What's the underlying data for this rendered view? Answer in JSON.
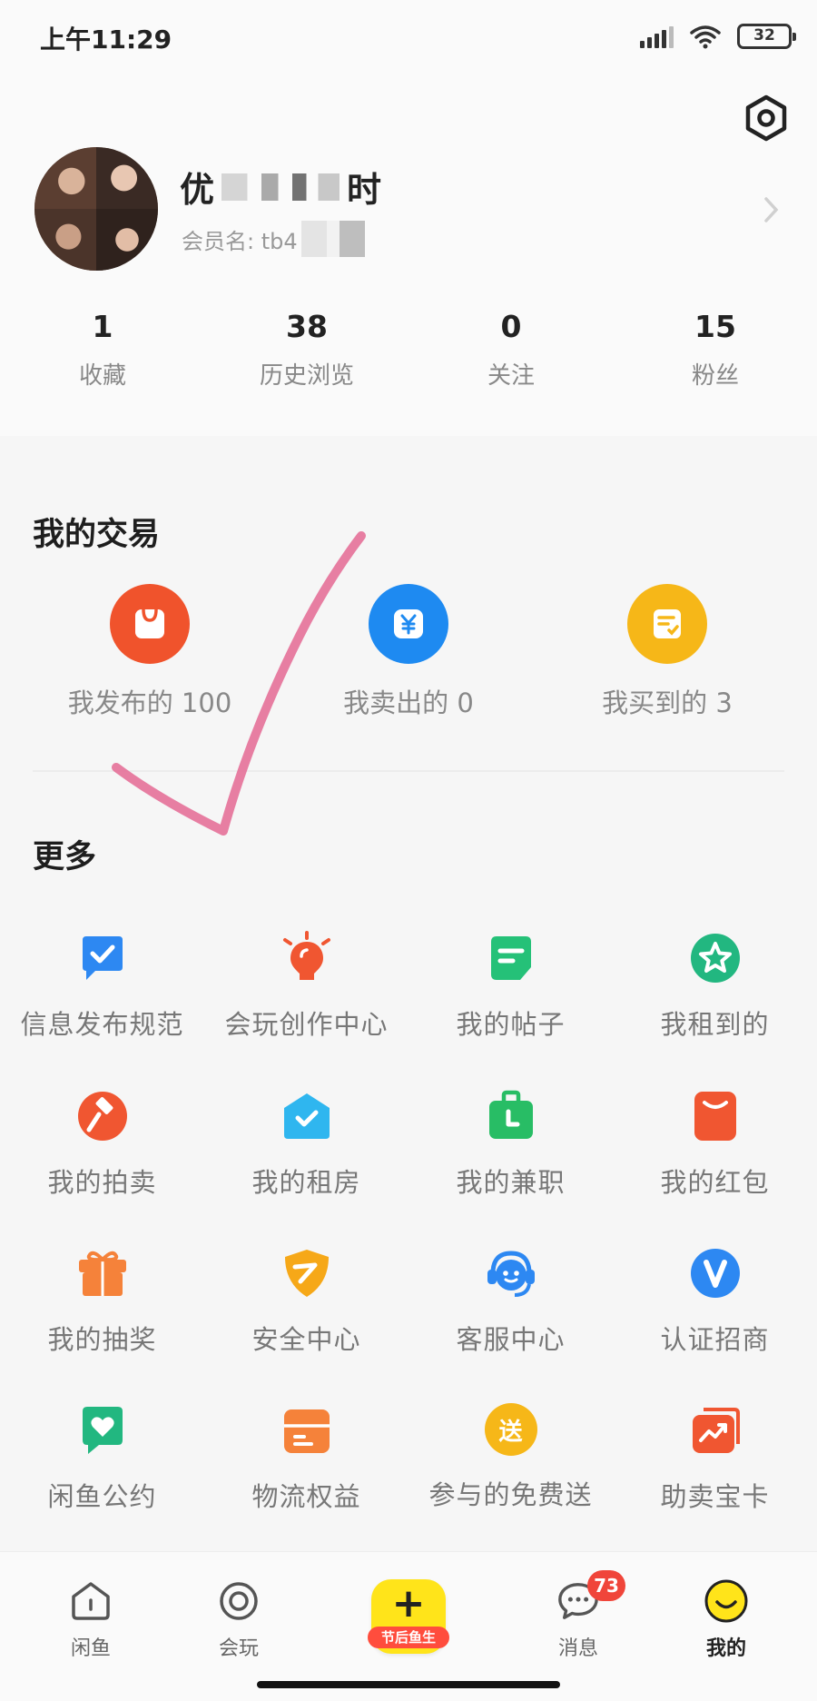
{
  "status_bar": {
    "time": "上午11:29",
    "battery": "32"
  },
  "profile": {
    "name_start": "优",
    "name_end": "时",
    "member_prefix": "会员名: tb4",
    "stats": [
      {
        "value": "1",
        "label": "收藏"
      },
      {
        "value": "38",
        "label": "历史浏览"
      },
      {
        "value": "0",
        "label": "关注"
      },
      {
        "value": "15",
        "label": "粉丝"
      }
    ]
  },
  "trade": {
    "title": "我的交易",
    "items": [
      {
        "label": "我发布的 100",
        "icon": "bag-icon",
        "color": "#f0532c"
      },
      {
        "label": "我卖出的 0",
        "icon": "yen-icon",
        "color": "#1e8af1"
      },
      {
        "label": "我买到的 3",
        "icon": "receipt-icon",
        "color": "#f6b718"
      }
    ]
  },
  "more": {
    "title": "更多",
    "items": [
      {
        "label": "信息发布规范",
        "icon": "check-doc-icon",
        "color": "#2d88f2"
      },
      {
        "label": "会玩创作中心",
        "icon": "bulb-icon",
        "color": "#f05631"
      },
      {
        "label": "我的帖子",
        "icon": "post-icon",
        "color": "#25c178"
      },
      {
        "label": "我租到的",
        "icon": "star-badge-icon",
        "color": "#22b780"
      },
      {
        "label": "我的拍卖",
        "icon": "gavel-icon",
        "color": "#f05631"
      },
      {
        "label": "我的租房",
        "icon": "house-check-icon",
        "color": "#2fb6ef"
      },
      {
        "label": "我的兼职",
        "icon": "briefcase-icon",
        "color": "#28bd65"
      },
      {
        "label": "我的红包",
        "icon": "red-packet-icon",
        "color": "#f05631"
      },
      {
        "label": "我的抽奖",
        "icon": "gift-icon",
        "color": "#f5823a"
      },
      {
        "label": "安全中心",
        "icon": "shield-icon",
        "color": "#f6a818"
      },
      {
        "label": "客服中心",
        "icon": "headset-icon",
        "color": "#2d88f2"
      },
      {
        "label": "认证招商",
        "icon": "verified-v-icon",
        "color": "#2d88f2"
      },
      {
        "label": "闲鱼公约",
        "icon": "heart-doc-icon",
        "color": "#22b780"
      },
      {
        "label": "物流权益",
        "icon": "box-icon",
        "color": "#f5823a"
      },
      {
        "label": "参与的免费送",
        "icon": "free-gift-icon",
        "color": "#f6b718",
        "glyph": "送"
      },
      {
        "label": "助卖宝卡",
        "icon": "trend-card-icon",
        "color": "#f05631"
      }
    ]
  },
  "bottom_nav": {
    "items": [
      {
        "label": "闲鱼",
        "icon": "home-icon"
      },
      {
        "label": "会玩",
        "icon": "target-icon"
      },
      {
        "label": "消息",
        "icon": "chat-icon",
        "badge": "73"
      },
      {
        "label": "我的",
        "icon": "smiley-icon",
        "active": true
      }
    ],
    "center": {
      "plus": "+",
      "caption": "节后鱼生"
    }
  }
}
